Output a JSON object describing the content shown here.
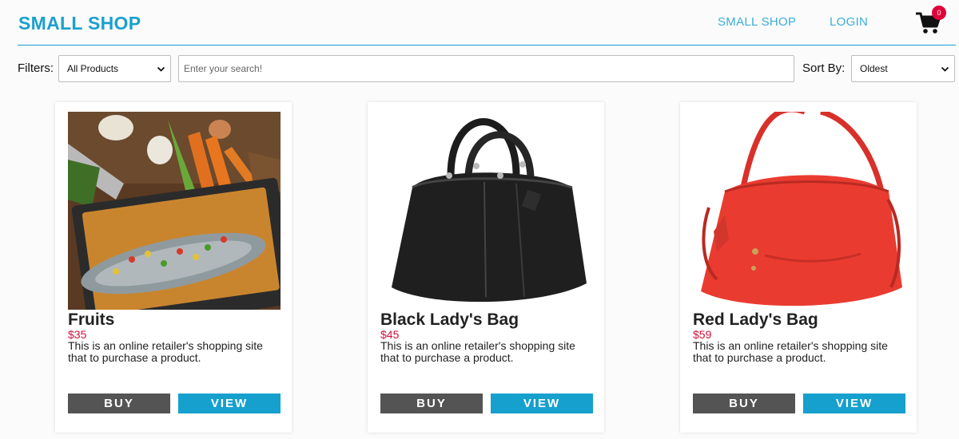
{
  "header": {
    "brand": "SMALL SHOP",
    "nav": [
      {
        "label": "SMALL SHOP"
      },
      {
        "label": "LOGIN"
      }
    ],
    "cart_count": "0"
  },
  "filters": {
    "label": "Filters:",
    "selected": "All Products",
    "search_placeholder": "Enter your search!",
    "sort_label": "Sort By:",
    "sort_selected": "Oldest"
  },
  "products": [
    {
      "name": "Fruits",
      "price": "$35",
      "description": "This is an online retailer's shopping site that to purchase a product.",
      "buy_label": "BUY",
      "view_label": "VIEW"
    },
    {
      "name": "Black Lady's Bag",
      "price": "$45",
      "description": "This is an online retailer's shopping site that to purchase a product.",
      "buy_label": "BUY",
      "view_label": "VIEW"
    },
    {
      "name": "Red Lady's Bag",
      "price": "$59",
      "description": "This is an online retailer's shopping site that to purchase a product.",
      "buy_label": "BUY",
      "view_label": "VIEW"
    }
  ],
  "colors": {
    "brand": "#1aa0cf",
    "price": "#d4103b",
    "buy_button": "#545454",
    "view_button": "#16a0cd",
    "badge": "#e0003a"
  },
  "icons": {
    "cart": "shopping-cart-icon",
    "select_arrow": "chevron-down-icon"
  }
}
